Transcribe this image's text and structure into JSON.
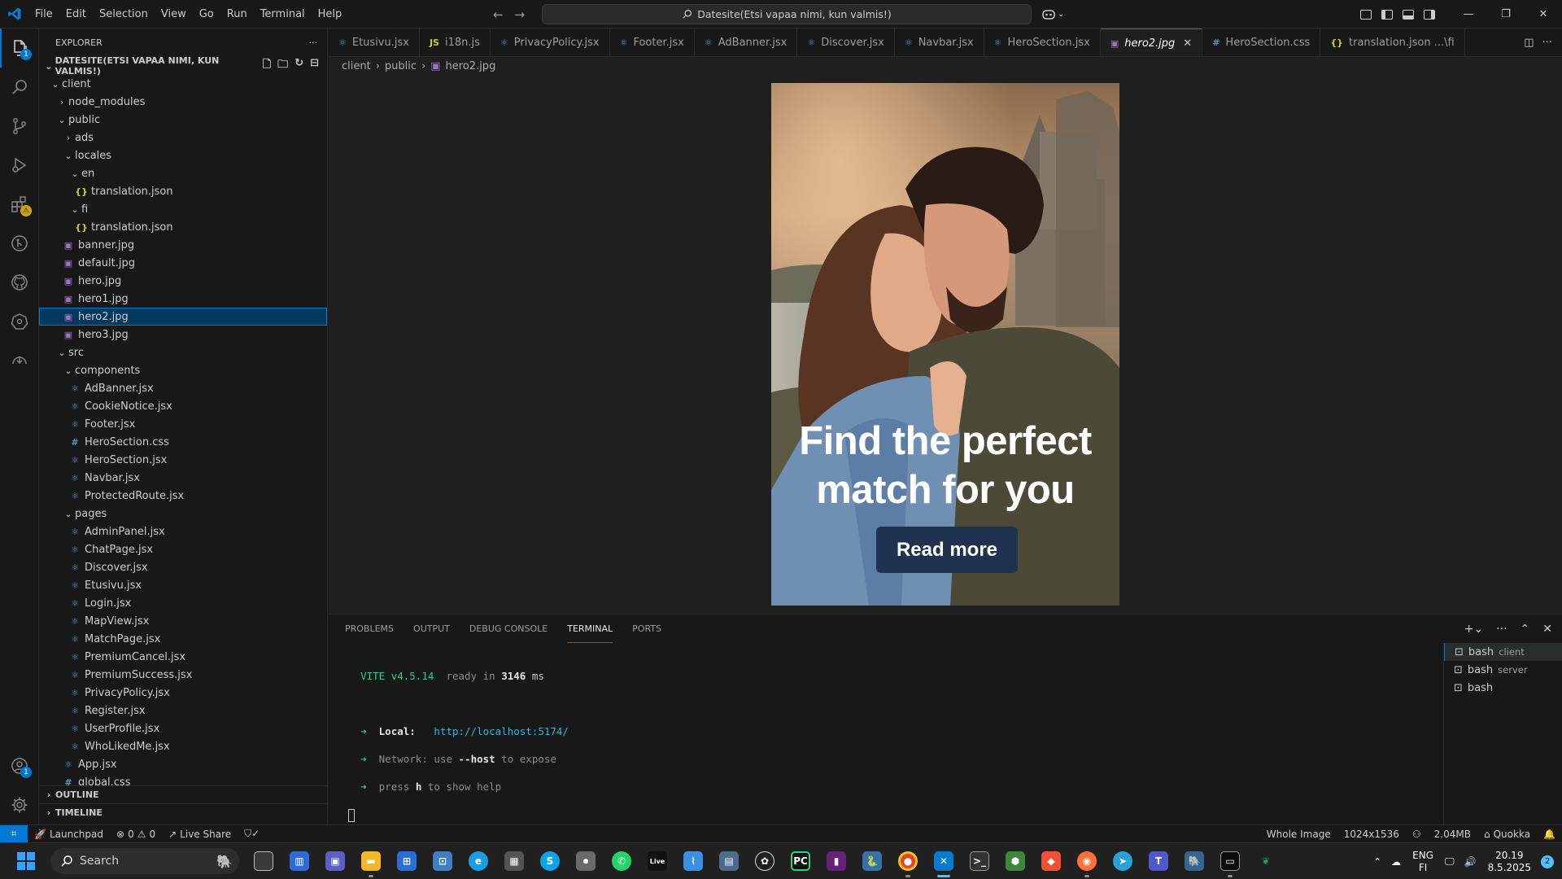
{
  "titlebar": {
    "menu": [
      "File",
      "Edit",
      "Selection",
      "View",
      "Go",
      "Run",
      "Terminal",
      "Help"
    ],
    "command_center": "Datesite(Etsi vapaa nimi, kun valmis!)"
  },
  "explorer": {
    "header": "EXPLORER",
    "root": "DATESITE(ETSI VAPAA NIMI, KUN VALMIS!)",
    "tree": [
      {
        "label": "client",
        "depth": 0,
        "kind": "folder-open"
      },
      {
        "label": "node_modules",
        "depth": 1,
        "kind": "folder"
      },
      {
        "label": "public",
        "depth": 1,
        "kind": "folder-open"
      },
      {
        "label": "ads",
        "depth": 2,
        "kind": "folder"
      },
      {
        "label": "locales",
        "depth": 2,
        "kind": "folder-open"
      },
      {
        "label": "en",
        "depth": 3,
        "kind": "folder-open"
      },
      {
        "label": "translation.json",
        "depth": 4,
        "kind": "json"
      },
      {
        "label": "fi",
        "depth": 3,
        "kind": "folder-open"
      },
      {
        "label": "translation.json",
        "depth": 4,
        "kind": "json"
      },
      {
        "label": "banner.jpg",
        "depth": 2,
        "kind": "img"
      },
      {
        "label": "default.jpg",
        "depth": 2,
        "kind": "img"
      },
      {
        "label": "hero.jpg",
        "depth": 2,
        "kind": "img"
      },
      {
        "label": "hero1.jpg",
        "depth": 2,
        "kind": "img"
      },
      {
        "label": "hero2.jpg",
        "depth": 2,
        "kind": "img",
        "selected": true
      },
      {
        "label": "hero3.jpg",
        "depth": 2,
        "kind": "img"
      },
      {
        "label": "src",
        "depth": 1,
        "kind": "folder-open"
      },
      {
        "label": "components",
        "depth": 2,
        "kind": "folder-open"
      },
      {
        "label": "AdBanner.jsx",
        "depth": 3,
        "kind": "react"
      },
      {
        "label": "CookieNotice.jsx",
        "depth": 3,
        "kind": "react"
      },
      {
        "label": "Footer.jsx",
        "depth": 3,
        "kind": "react"
      },
      {
        "label": "HeroSection.css",
        "depth": 3,
        "kind": "css"
      },
      {
        "label": "HeroSection.jsx",
        "depth": 3,
        "kind": "react"
      },
      {
        "label": "Navbar.jsx",
        "depth": 3,
        "kind": "react"
      },
      {
        "label": "ProtectedRoute.jsx",
        "depth": 3,
        "kind": "react"
      },
      {
        "label": "pages",
        "depth": 2,
        "kind": "folder-open"
      },
      {
        "label": "AdminPanel.jsx",
        "depth": 3,
        "kind": "react"
      },
      {
        "label": "ChatPage.jsx",
        "depth": 3,
        "kind": "react"
      },
      {
        "label": "Discover.jsx",
        "depth": 3,
        "kind": "react"
      },
      {
        "label": "Etusivu.jsx",
        "depth": 3,
        "kind": "react"
      },
      {
        "label": "Login.jsx",
        "depth": 3,
        "kind": "react"
      },
      {
        "label": "MapView.jsx",
        "depth": 3,
        "kind": "react"
      },
      {
        "label": "MatchPage.jsx",
        "depth": 3,
        "kind": "react"
      },
      {
        "label": "PremiumCancel.jsx",
        "depth": 3,
        "kind": "react"
      },
      {
        "label": "PremiumSuccess.jsx",
        "depth": 3,
        "kind": "react"
      },
      {
        "label": "PrivacyPolicy.jsx",
        "depth": 3,
        "kind": "react"
      },
      {
        "label": "Register.jsx",
        "depth": 3,
        "kind": "react"
      },
      {
        "label": "UserProfile.jsx",
        "depth": 3,
        "kind": "react"
      },
      {
        "label": "WhoLikedMe.jsx",
        "depth": 3,
        "kind": "react"
      },
      {
        "label": "App.jsx",
        "depth": 2,
        "kind": "react"
      },
      {
        "label": "global.css",
        "depth": 2,
        "kind": "css"
      }
    ],
    "outline": "OUTLINE",
    "timeline": "TIMELINE"
  },
  "tabs": [
    {
      "label": "Etusivu.jsx",
      "kind": "react"
    },
    {
      "label": "i18n.js",
      "kind": "js"
    },
    {
      "label": "PrivacyPolicy.jsx",
      "kind": "react"
    },
    {
      "label": "Footer.jsx",
      "kind": "react"
    },
    {
      "label": "AdBanner.jsx",
      "kind": "react"
    },
    {
      "label": "Discover.jsx",
      "kind": "react"
    },
    {
      "label": "Navbar.jsx",
      "kind": "react"
    },
    {
      "label": "HeroSection.jsx",
      "kind": "react"
    },
    {
      "label": "hero2.jpg",
      "kind": "img",
      "active": true
    },
    {
      "label": "HeroSection.css",
      "kind": "css"
    },
    {
      "label": "translation.json ...\\fi",
      "kind": "json"
    }
  ],
  "breadcrumb": [
    "client",
    "public",
    "hero2.jpg"
  ],
  "hero_image": {
    "title_line1": "Find the perfect",
    "title_line2": "match for you",
    "button": "Read more"
  },
  "panel": {
    "tabs": [
      "PROBLEMS",
      "OUTPUT",
      "DEBUG CONSOLE",
      "TERMINAL",
      "PORTS"
    ],
    "active_tab": "TERMINAL",
    "terminal": {
      "vite": "VITE",
      "version": "v4.5.14",
      "ready": "ready in",
      "ms_value": "3146",
      "ms_unit": "ms",
      "local_label": "Local:",
      "local_url": "http://localhost:5174/",
      "network_label": "Network:",
      "network_pre": "use",
      "network_flag": "--host",
      "network_post": "to expose",
      "help_pre": "press",
      "help_key": "h",
      "help_post": "to show help"
    },
    "terminals": [
      {
        "name": "bash",
        "sub": "client",
        "active": true
      },
      {
        "name": "bash",
        "sub": "server"
      },
      {
        "name": "bash",
        "sub": ""
      }
    ]
  },
  "statusbar": {
    "launchpad": "Launchpad",
    "errors": "0",
    "warnings": "0",
    "live_share": "Live Share",
    "whole_image": "Whole Image",
    "dimensions": "1024x1536",
    "size": "2.04MB",
    "quokka": "Quokka"
  },
  "taskbar": {
    "search": "Search",
    "lang_top": "ENG",
    "lang_bottom": "FI",
    "time": "20.19",
    "date": "8.5.2025",
    "notifications": "2"
  },
  "colors": {
    "accent": "#0078d4",
    "selection": "#04395e",
    "hero_button": "#1f3350"
  }
}
